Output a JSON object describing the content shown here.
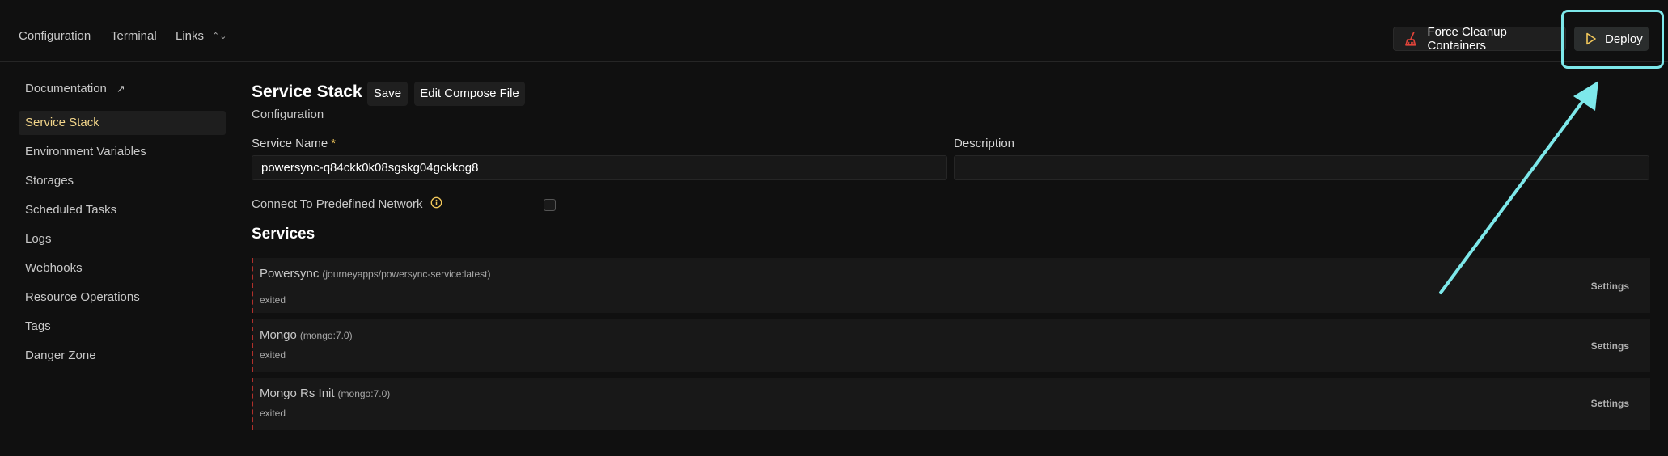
{
  "nav": {
    "configuration": "Configuration",
    "terminal": "Terminal",
    "links": "Links"
  },
  "actions": {
    "force_cleanup": "Force Cleanup Containers",
    "deploy": "Deploy"
  },
  "sidebar": {
    "items": [
      {
        "label": "Documentation",
        "external_icon": "↗"
      },
      {
        "label": "Service Stack",
        "active": true
      },
      {
        "label": "Environment Variables"
      },
      {
        "label": "Storages"
      },
      {
        "label": "Scheduled Tasks"
      },
      {
        "label": "Logs"
      },
      {
        "label": "Webhooks"
      },
      {
        "label": "Resource Operations"
      },
      {
        "label": "Tags"
      },
      {
        "label": "Danger Zone"
      }
    ]
  },
  "page": {
    "title": "Service Stack",
    "save": "Save",
    "edit_compose": "Edit Compose File",
    "subtitle": "Configuration"
  },
  "form": {
    "service_name_label": "Service Name",
    "required_mark": "*",
    "service_name_value": "powersync-q84ckk0k08sgskg04gckkog8",
    "description_label": "Description",
    "description_value": "",
    "network_label": "Connect To Predefined Network",
    "network_checked": false
  },
  "services": {
    "title": "Services",
    "items": [
      {
        "name": "Powersync",
        "image": "(journeyapps/powersync-service:latest)",
        "status": "exited",
        "settings": "Settings"
      },
      {
        "name": "Mongo",
        "image": "(mongo:7.0)",
        "status": "exited",
        "settings": "Settings"
      },
      {
        "name": "Mongo Rs Init",
        "image": "(mongo:7.0)",
        "status": "exited",
        "settings": "Settings"
      }
    ]
  },
  "colors": {
    "accent_active": "#f2d58a",
    "highlight": "#7de8ea",
    "danger_border": "#b0302b",
    "required": "#f2c85b"
  }
}
